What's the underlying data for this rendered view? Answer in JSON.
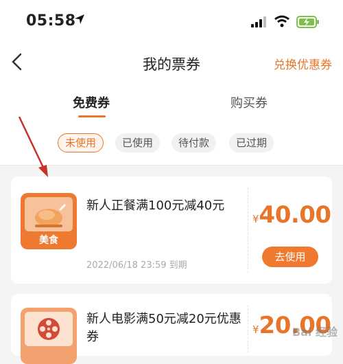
{
  "status_bar": {
    "time": "05:58",
    "icons": [
      "location-arrow-icon",
      "signal-icon",
      "wifi-icon",
      "battery-charging-icon"
    ]
  },
  "nav": {
    "title": "我的票券",
    "right_action": "兑换优惠券",
    "back_icon": "chevron-left-icon"
  },
  "tabs": [
    {
      "label": "免费券",
      "active": true
    },
    {
      "label": "购买券",
      "active": false
    }
  ],
  "filters": [
    {
      "label": "未使用",
      "active": true
    },
    {
      "label": "已使用",
      "active": false
    },
    {
      "label": "待付款",
      "active": false
    },
    {
      "label": "已过期",
      "active": false
    }
  ],
  "coupons": [
    {
      "category": "美食",
      "title": "新人正餐满100元减40元",
      "expiry": "2022/06/18 23:59 到期",
      "currency": "¥",
      "amount": "40.00",
      "action": "去使用"
    },
    {
      "title": "新人电影满50元减20元优惠券",
      "currency": "¥",
      "amount": "20.00"
    }
  ],
  "colors": {
    "accent": "#e8762a",
    "annotation_arrow": "#c8322a"
  },
  "watermark": "Bai 经验"
}
